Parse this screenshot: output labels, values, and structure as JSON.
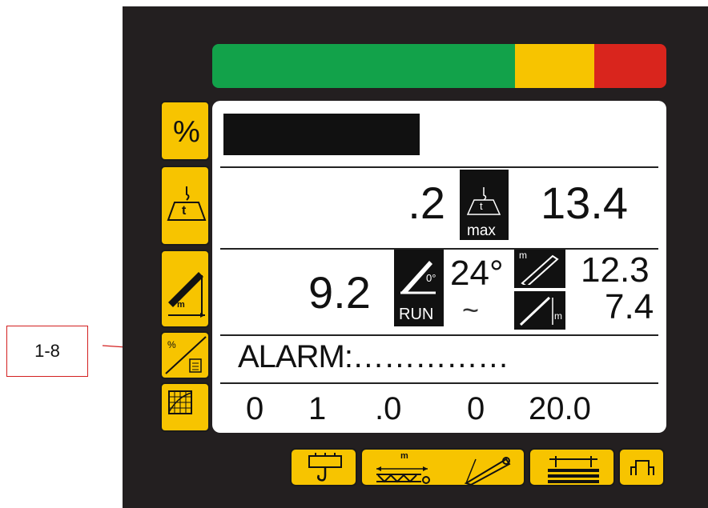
{
  "load_bar": {
    "segments": [
      {
        "color": "#12a24a",
        "fraction": 0.666
      },
      {
        "color": "#f7c400",
        "fraction": 0.176
      },
      {
        "color": "#d9251d",
        "fraction": 0.158
      }
    ]
  },
  "side_buttons": [
    {
      "id": "percent",
      "label": "%"
    },
    {
      "id": "load",
      "label": "t"
    },
    {
      "id": "boom",
      "label": "m"
    },
    {
      "id": "alarm",
      "label": ""
    },
    {
      "id": "grid",
      "label": ""
    }
  ],
  "screen": {
    "row_load": {
      "actual": ".2",
      "max": "13.4",
      "max_icon_label": "max",
      "icon_t": "t"
    },
    "row_boom": {
      "radius": "9.2",
      "angle": "24°",
      "angle_icon_sub": "0°",
      "run_label": "RUN",
      "wave_symbol": "~",
      "boom_length": "12.3",
      "height": "7.4",
      "length_icon_m": "m",
      "height_icon_m": "m"
    },
    "alarm_text": "ALARM:……………",
    "bottom_row": [
      "0",
      "1",
      ".0",
      "0",
      "20.0"
    ]
  },
  "bottom_buttons": [
    {
      "id": "hook"
    },
    {
      "id": "outrigger",
      "label": "m"
    },
    {
      "id": "jib"
    },
    {
      "id": "counterweight"
    },
    {
      "id": "setup"
    }
  ],
  "callout": {
    "label": "1-8"
  },
  "colors": {
    "panel": "#231f20",
    "yellow": "#f7c400",
    "green": "#12a24a",
    "red": "#d9251d",
    "callout_border": "#d32020"
  }
}
